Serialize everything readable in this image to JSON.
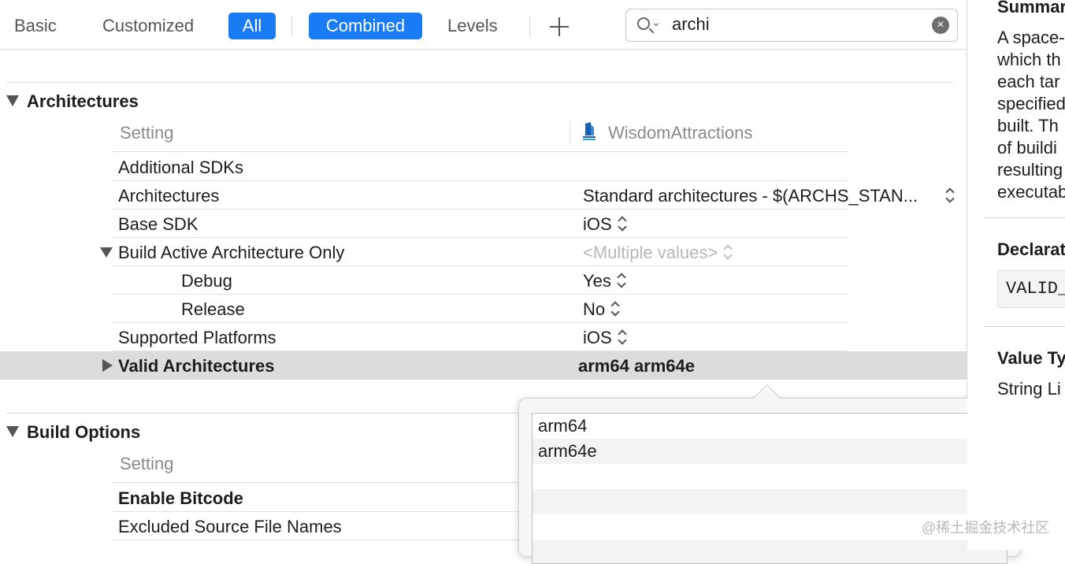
{
  "toolbar": {
    "basic": "Basic",
    "customized": "Customized",
    "all": "All",
    "combined": "Combined",
    "levels": "Levels"
  },
  "search": {
    "value": "archi"
  },
  "sections": {
    "architectures": "Architectures",
    "build_options": "Build Options"
  },
  "columns": {
    "setting": "Setting",
    "target": "WisdomAttractions",
    "setting2": "Setting"
  },
  "rows": [
    {
      "name": "Additional SDKs",
      "value": ""
    },
    {
      "name": "Architectures",
      "value": "Standard architectures  -  $(ARCHS_STAN..."
    },
    {
      "name": "Base SDK",
      "value": "iOS"
    },
    {
      "name": "Build Active Architecture Only",
      "value": "<Multiple values>"
    },
    {
      "name": "Debug",
      "value": "Yes"
    },
    {
      "name": "Release",
      "value": "No"
    },
    {
      "name": "Supported Platforms",
      "value": "iOS"
    },
    {
      "name": "Valid Architectures",
      "value": "arm64 arm64e"
    }
  ],
  "build_rows": [
    {
      "name": "Enable Bitcode"
    },
    {
      "name": "Excluded Source File Names"
    }
  ],
  "popover": {
    "items": [
      "arm64",
      "arm64e"
    ]
  },
  "inspector": {
    "summary_title": "Summary",
    "summary_lines": [
      "A space-",
      "which th",
      "each tar",
      "specified",
      "built. Th",
      "of buildi",
      "resulting",
      "executab"
    ],
    "declaration_title": "Declarat",
    "declaration_value": "VALID_",
    "value_type_title": "Value Ty",
    "value_type": "String Li"
  },
  "watermark": "@稀土掘金技术社区",
  "colors": {
    "accent": "#1a7cf5",
    "selected_row": "#dcdcdc"
  },
  "icons": [
    "search-icon",
    "chevron-down-icon",
    "clear-icon",
    "plus-icon",
    "disclosure-triangle-icon",
    "up-down-stepper-icon",
    "app-target-icon"
  ]
}
